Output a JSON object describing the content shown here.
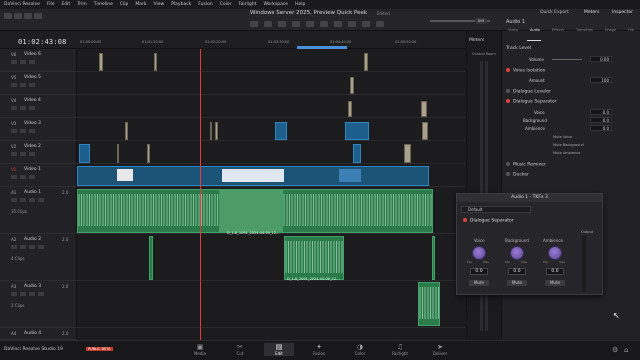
{
  "menu": [
    "DaVinci Resolve",
    "File",
    "Edit",
    "Trim",
    "Timeline",
    "Clip",
    "Mark",
    "View",
    "Playback",
    "Fusion",
    "Color",
    "Fairlight",
    "Workspace",
    "Help"
  ],
  "project": {
    "title": "Windows Server 2025, Preview Quick Peek",
    "status": "Edited"
  },
  "toolbar": {
    "quick_export": "Quick Export",
    "meters": "Meters",
    "inspector": "Inspector",
    "dim": "DIM"
  },
  "timecode": "01:02:43:08",
  "ruler": [
    "01:00:00:00",
    "01:01:10:00",
    "01:02:20:00",
    "01:03:30:00",
    "01:04:40:00",
    "01:05:50:00"
  ],
  "video_tracks": [
    {
      "code": "V6",
      "name": "Video 6"
    },
    {
      "code": "V5",
      "name": "Video 5"
    },
    {
      "code": "V4",
      "name": "Video 4"
    },
    {
      "code": "V3",
      "name": "Video 3"
    },
    {
      "code": "V2",
      "name": "Video 2"
    },
    {
      "code": "V1",
      "name": "Video 1"
    }
  ],
  "audio_tracks": [
    {
      "code": "A1",
      "name": "Audio 1",
      "level": "2.0",
      "clips": "35 Clips"
    },
    {
      "code": "A2",
      "name": "Audio 2",
      "level": "2.0",
      "clips": "4 Clips"
    },
    {
      "code": "A3",
      "name": "Audio 3",
      "level": "2.0",
      "clips": "2 Clips"
    },
    {
      "code": "A4",
      "name": "Audio 4",
      "level": "2.0",
      "clips": ""
    }
  ],
  "clip_labels": {
    "a1_center": "D_1-8_1091_2024-04-09_12...",
    "a2_center": "D_1-8_1091_2024-04-09_12..."
  },
  "meters": {
    "title": "Meters",
    "control_room": "Control Room"
  },
  "inspector": {
    "clip_name": "Audio 1",
    "tabs": [
      "Video",
      "Audio",
      "Effects",
      "Transition",
      "Image",
      "File"
    ],
    "track_level": "Track Level",
    "volume_label": "Volume",
    "volume_value": "0.00",
    "voice_isolation": "Voice Isolation",
    "amount_label": "Amount",
    "amount_value": "100",
    "dialogue_leveler": "Dialogue Leveler",
    "dialogue_separator": "Dialogue Separator",
    "voice_label": "Voice",
    "voice_value": "0.0",
    "background_label": "Background",
    "background_value": "0.0",
    "ambience_label": "Ambience",
    "ambience_value": "0.0",
    "mute_voice": "Mute Voice",
    "mute_background": "Mute Background",
    "mute_ambience": "Mute Ambience",
    "music_remixer": "Music Remixer",
    "ducker": "Ducker"
  },
  "fx_window": {
    "title": "Audio 1 - TKFx 3",
    "preset": "Default",
    "plugin": "Dialogue Separator",
    "output_label": "Output",
    "knobs": [
      {
        "label": "Voice",
        "min": "Min",
        "max": "Max",
        "value": "0.0",
        "mute": "Mute"
      },
      {
        "label": "Background",
        "min": "Min",
        "max": "Max",
        "value": "0.0",
        "mute": "Mute"
      },
      {
        "label": "Ambience",
        "min": "Min",
        "max": "Max",
        "value": "0.0",
        "mute": "Mute"
      }
    ]
  },
  "footer": {
    "app": "DaVinci Resolve Studio 19",
    "badge": "PUBLIC BETA"
  },
  "pages": [
    "Media",
    "Cut",
    "Edit",
    "Fusion",
    "Color",
    "Fairlight",
    "Deliver"
  ],
  "colors": {
    "accent": "#e04040",
    "audio_clip": "#2a7a4a",
    "video_clip": "#1d5f8c",
    "playhead": "#e33a3a"
  }
}
